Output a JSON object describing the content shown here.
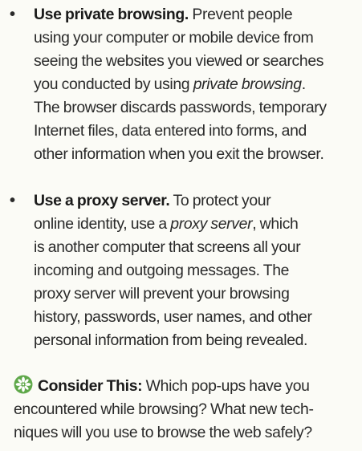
{
  "bullets": [
    {
      "lead": "Use private browsing.",
      "line1_rest": " Prevent people",
      "line2": "using your computer or mobile device from",
      "line3": "seeing the websites you viewed or searches",
      "line4_pre": "you conducted by using ",
      "line4_em": "private browsing",
      "line4_post": ".",
      "line5": "The browser discards passwords, temporary",
      "line6": "Internet files, data entered into forms, and",
      "line7": "other information when you exit the browser."
    },
    {
      "lead": "Use a proxy server.",
      "line1_rest": " To protect your",
      "line2_pre": "online identity, use a ",
      "line2_em": "proxy server",
      "line2_post": ", which",
      "line3": "is another computer that screens all your",
      "line4": "incoming and outgoing messages. The",
      "line5": "proxy server will prevent your browsing",
      "line6": "history, passwords, user names, and other",
      "line7": "personal information from being revealed."
    }
  ],
  "consider": {
    "icon": "consider-this-icon",
    "label": "Consider This:",
    "line1_rest": " Which pop-ups have you",
    "line2": "encountered while browsing? What new tech-",
    "line3": "niques will you use to browse the web safely?"
  },
  "colors": {
    "icon_green": "#5fa84a",
    "text": "#2a2a2a",
    "background": "#fbfbf6"
  }
}
